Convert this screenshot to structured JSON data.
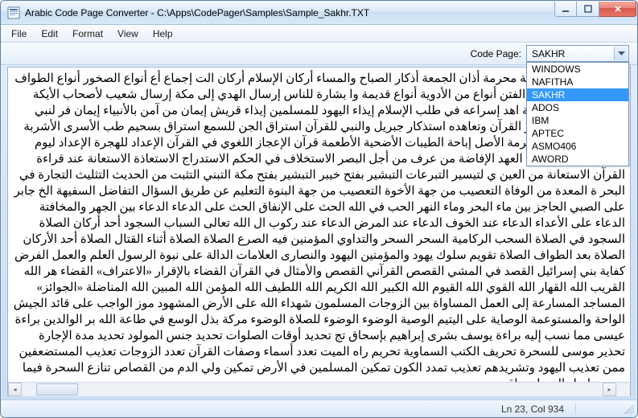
{
  "window": {
    "title": "Arabic Code Page Converter - C:\\Apps\\CodePager\\Samples\\Sample_Sakhr.TXT"
  },
  "menu": {
    "items": [
      "File",
      "Edit",
      "Format",
      "View",
      "Help"
    ]
  },
  "toolbar": {
    "codepage_label": "Code Page:",
    "combo": {
      "selected": "SAKHR",
      "options": [
        "WINDOWS",
        "NAFITHA",
        "SAKHR",
        "ADOS",
        "IBM",
        "APTEC",
        "ASMO406",
        "AWORD"
      ]
    }
  },
  "content": {
    "text": "رون أوات الصيد أدوية محرمة أذان الجمعة أذكار الصباح والمساء أركان الإسلام أركان الت إجماع أع أنواع الصخور أنواع الطواف أنواع العقوبات أنواع الفتن أنواع من الأدوية أنواع قديمة وا بشارة للناس إرسال الهدي إلى مكة إرسال شعيب لأصحاب الأيكة إرضاء الله للنبي إزالة اهد إسراعه في طلب الإسلام إيذاء اليهود للمسلمين إيذاء قريش إيمان من آمن بالأنبياء إيمان فر لنبي استحابة الله استذكار القرآن وتعاهده استذكار جبريل والنبي للقرآن استراق الجن للسمع استراق بسحيم طب الأسرى الأشربة والأطعمة الأشهر الحرمة الأصل إباحة الطيبات الأضحية الأطعمة قرآن الإعجاز اللغوي في القرآن الإعداد للهجرة الإعداد ليوم القيامة الإعلام بنقض العهد الإفاضة من عرف من أجل البصر الاستخلاف في الحكم الاستدراج الاستعاذة الاستعانة عند قراءة القرآن الاستعانة من العين ي لتيسير التبرعات التبشير بفتح خيبر التبشير بفتح مكة التبني التثبت من الحديث التثليث التجارة في البحر ة المعدة من الوفاة التعصيب من جهة الأخوة التعصيب من جهة البنوة التعليم عن طريق السؤال التفاضل السفيهة الخ جابر على الصبي الحاجز بين ماء البحر وماء النهر الحب في الله الحث على الإنفاق الحث على الدعاء الدعاء بين الجهر والمخافتة الدعاء على الأعداء الدعاء عند الخوف الدعاء عند المرض الدعاء عند ركوب ال الله تعالى السباب السجود أحد أركان الصلاة السجود في الصلاة السحب الركامية السحر السحر والتداوي المؤمنين فيه الصرع الصلاة الصلاة أثناء القتال الصلاة أحد الأركان الصلاة بعد الطواف الصلاة تقويم سلوك يهود والمؤمنين اليهود والنصارى العلامات الدالة على نبوة الرسول العلم والعمل الفرض كفاية بني إسرائيل القصد في المشي القصص القرآني القصص والأمثال في القرآن القضاء بالإقرار «الاعتراف» القضاء هر الله القريب الله القهار الله القوي الله القيوم الله الكبير الله الكريم الله اللطيف الله المؤمن الله المبين الله المناضلة «الجوائز» المساجد المسارعة إلى العمل المساواة بين الزوجات المسلمون شهداء الله على الأرض المشهود موز الواجب على قائد الجيش الواحة والمستوعمة الوصاية على اليتيم الوصية الوضوء الوضوء للصلاة الوضوء مركة بذل الوسع في طاعة الله بر الوالدين براءة عيسى مما نسب إليه براءة يوسف بشرى إبراهيم بإسحاق تج تحديد أوقات الصلوات تحديد جنس المولود تحديد مدة الإجارة تحذير موسى للسحرة تحريف الكتب السماوية تحريم راه الميت تعدد أسماء وصفات القرآن تعدد الزوجات تعذيب المستضعفين ممن تعذيب اليهود وتشريدهم تعذيب تمدد الكون تمكين المسلمين في الأرض تمكين ولي الدم من القصاص تنازع السحرة فيما بينهم تناسل الحيوان تناق"
  },
  "status": {
    "ln": "Ln 23, Col 934"
  }
}
